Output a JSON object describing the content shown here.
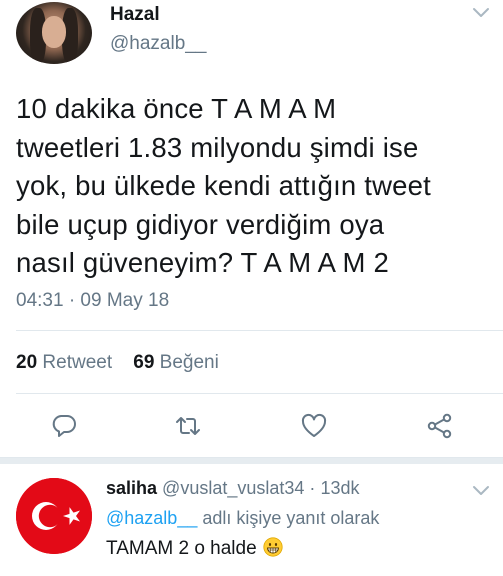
{
  "tweet": {
    "author_name": "Hazal",
    "author_handle": "@hazalb__",
    "text_lines": [
      "10 dakika önce T A M A M",
      "tweetleri 1.83 milyondu şimdi ise",
      "yok, bu ülkede kendi attığın tweet",
      "bile uçup gidiyor verdiğim oya",
      "nasıl güveneyim? T A M A M 2"
    ],
    "timestamp": "04:31 · 09 May 18",
    "retweet_count": "20",
    "retweet_label": "Retweet",
    "like_count": "69",
    "like_label": "Beğeni"
  },
  "actions": {
    "icons": [
      "reply-icon",
      "retweet-icon",
      "like-icon",
      "share-icon"
    ]
  },
  "reply": {
    "author_name": "saliha",
    "author_handle": "@vuslat_vuslat34",
    "separator": "·",
    "time": "13dk",
    "reply_to_handle": "@hazalb__",
    "reply_to_suffix": " adlı kişiye yanıt olarak",
    "text": "TAMAM 2 o halde",
    "emoji": "grinning-face-emoji"
  },
  "colors": {
    "text": "#14171a",
    "secondary": "#657786",
    "link": "#1da1f2",
    "divider": "#e1e8ed",
    "flag_red": "#e30a17"
  }
}
